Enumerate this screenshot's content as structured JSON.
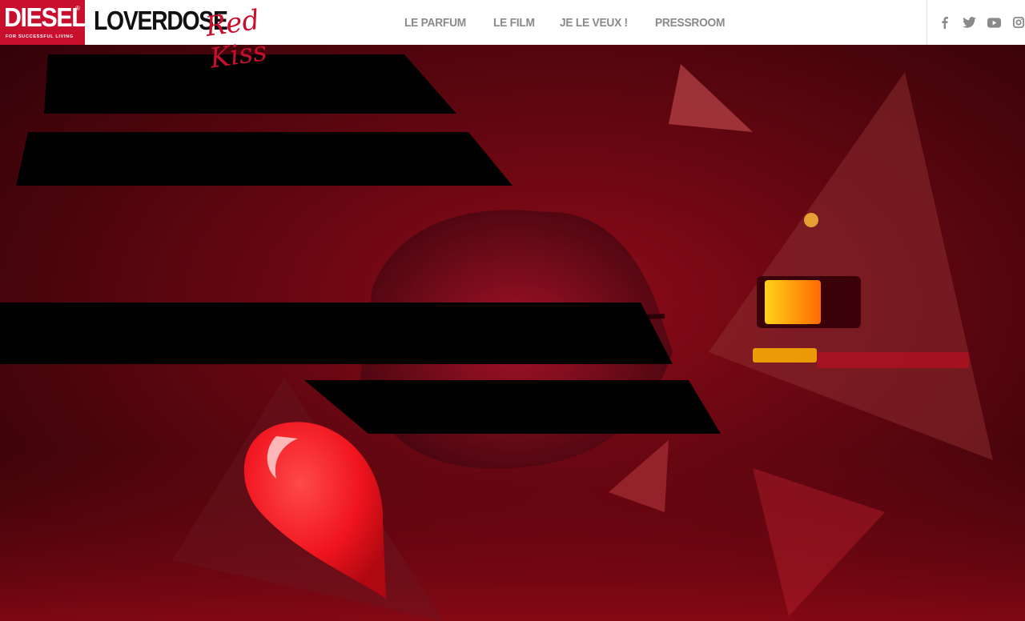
{
  "brand": {
    "name": "DIESEL",
    "registered": "®",
    "tagline": "FOR SUCCESSFUL LIVING",
    "product_name": "LOVERDOSE",
    "product_script": "Red Kiss"
  },
  "nav": {
    "items": [
      "LE PARFUM",
      "LE FILM",
      "JE LE VEUX !",
      "PRESSROOM"
    ]
  },
  "social": {
    "icons": [
      "facebook-icon",
      "twitter-icon",
      "youtube-icon",
      "instagram-icon"
    ]
  },
  "colors": {
    "brand_red": "#c8102e",
    "nav_text": "#8a8a8a",
    "header_bg": "#ffffff",
    "hero_red": "#8e0b18"
  }
}
